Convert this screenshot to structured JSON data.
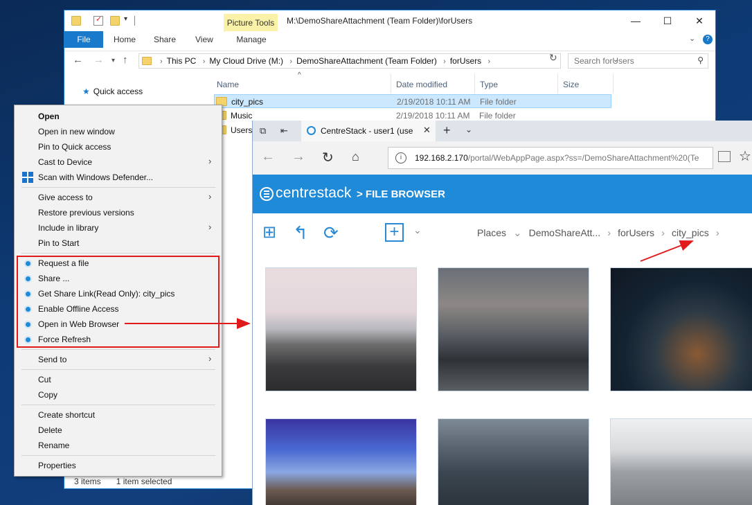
{
  "explorer": {
    "picture_tools": "Picture Tools",
    "title": "M:\\DemoShareAttachment (Team Folder)\\forUsers",
    "tabs": {
      "file": "File",
      "home": "Home",
      "share": "Share",
      "view": "View",
      "manage": "Manage"
    },
    "window_controls": {
      "minimize": "—",
      "maximize": "☐",
      "close": "✕"
    },
    "help": "?",
    "breadcrumbs": [
      "This PC",
      "My Cloud Drive (M:)",
      "DemoShareAttachment (Team Folder)",
      "forUsers"
    ],
    "search_placeholder": "Search forUsers",
    "nav_pane": {
      "quick_access": "Quick access"
    },
    "columns": {
      "name": "Name",
      "date": "Date modified",
      "type": "Type",
      "size": "Size"
    },
    "rows": [
      {
        "name": "city_pics",
        "date": "2/19/2018 10:11 AM",
        "type": "File folder"
      },
      {
        "name": "Music",
        "date": "2/19/2018 10:11 AM",
        "type": "File folder"
      },
      {
        "name": "Users"
      }
    ],
    "status": {
      "items": "3 items",
      "selected": "1 item selected"
    }
  },
  "context_menu": {
    "open": "Open",
    "open_new_window": "Open in new window",
    "pin_quick": "Pin to Quick access",
    "cast": "Cast to Device",
    "scan": "Scan with Windows Defender...",
    "give_access": "Give access to",
    "restore": "Restore previous versions",
    "include": "Include in library",
    "pin_start": "Pin to Start",
    "request_file": "Request a file",
    "share": "Share ...",
    "share_link": "Get Share Link(Read Only): city_pics",
    "offline": "Enable Offline Access",
    "open_web": "Open in Web Browser",
    "force_refresh": "Force Refresh",
    "send_to": "Send to",
    "cut": "Cut",
    "copy": "Copy",
    "create_shortcut": "Create shortcut",
    "delete": "Delete",
    "rename": "Rename",
    "properties": "Properties"
  },
  "browser": {
    "tab_title": "CentreStack - user1 (use",
    "url_host": "192.168.2.170",
    "url_path": "/portal/WebAppPage.aspx?ss=/DemoShareAttachment%20(Te",
    "logo": "centrestack",
    "section": "> FILE BROWSER",
    "crumbs": [
      "Places",
      "DemoShareAtt...",
      "forUsers",
      "city_pics"
    ]
  },
  "colors": {
    "accent": "#1979ca",
    "centrestack_blue": "#1e8ad8",
    "annotation_red": "#e01a1a",
    "selection": "#cce8ff"
  }
}
